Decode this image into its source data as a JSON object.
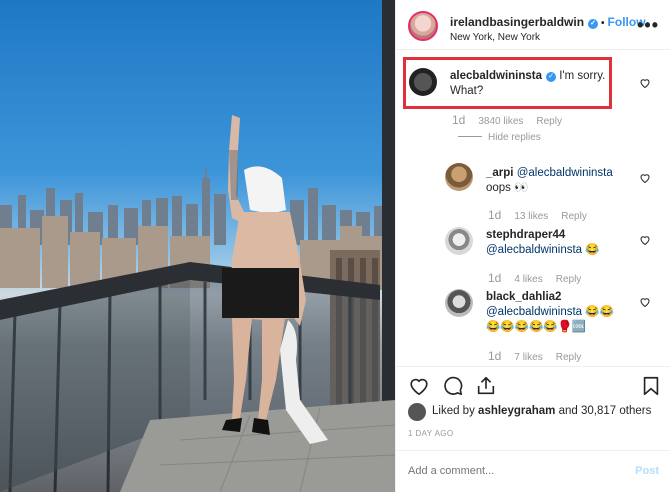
{
  "post": {
    "username": "irelandbasingerbaldwin",
    "follow_label": "Follow",
    "location": "New York, New York",
    "dot": "•"
  },
  "main_comment": {
    "username": "alecbaldwininsta",
    "text": "I'm sorry. What?",
    "age": "1d",
    "likes": "3840 likes",
    "reply_label": "Reply"
  },
  "hide_replies_label": "Hide replies",
  "replies": [
    {
      "username": "_arpi",
      "mention": "@alecbaldwininsta",
      "text": "oops 👀",
      "age": "1d",
      "likes": "13 likes",
      "reply_label": "Reply"
    },
    {
      "username": "stephdraper44",
      "mention": "@alecbaldwininsta",
      "text": "😂",
      "age": "1d",
      "likes": "4 likes",
      "reply_label": "Reply"
    },
    {
      "username": "black_dahlia2",
      "mention": "@alecbaldwininsta",
      "text": "😂😂",
      "line2": "😂😂😂😂😂🥊🆒",
      "age": "1d",
      "likes": "7 likes",
      "reply_label": "Reply"
    }
  ],
  "likes": {
    "prefix": "Liked by",
    "user": "ashleygraham",
    "suffix": "and 30,817 others"
  },
  "time_ago": "1 DAY AGO",
  "add_comment": {
    "placeholder": "Add a comment...",
    "post_label": "Post"
  },
  "icons": {
    "verified": "✓",
    "more": "•••"
  },
  "colors": {
    "accent": "#3897f0",
    "highlight": "#e0303a",
    "muted": "#999999"
  }
}
